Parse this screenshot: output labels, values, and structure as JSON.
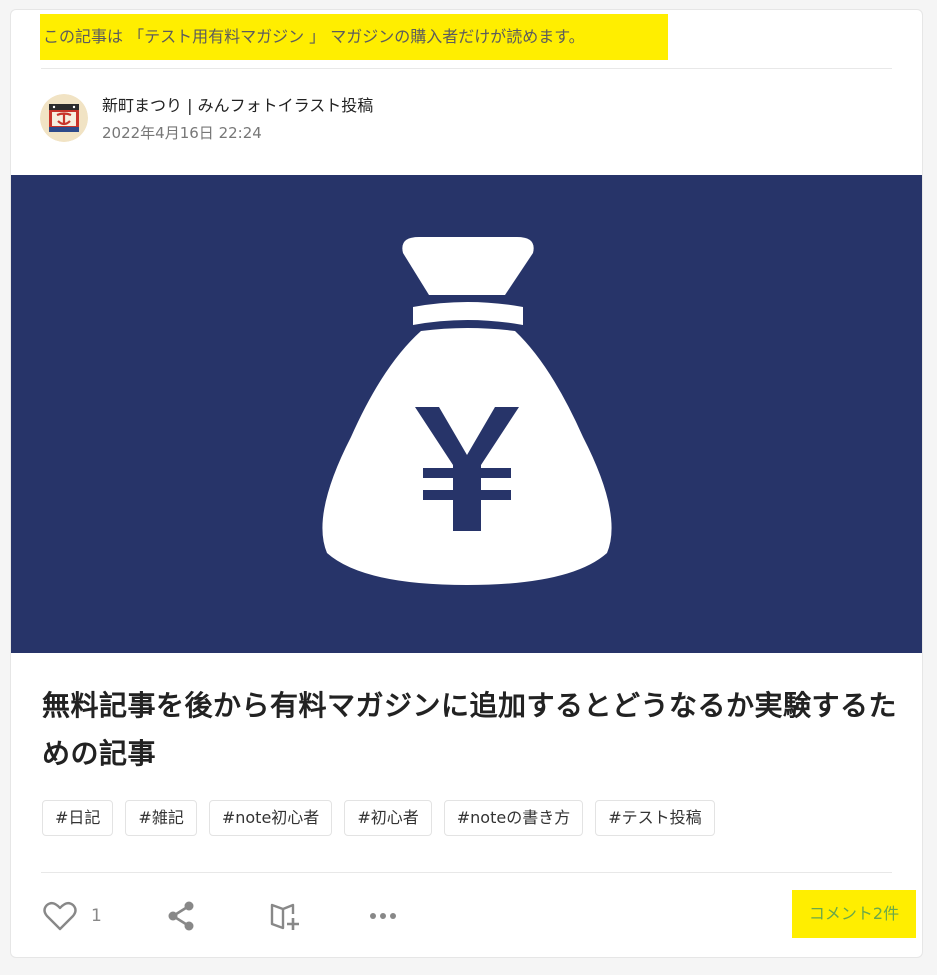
{
  "notice": {
    "text": "この記事は 「テスト用有料マガジン 」 マガジンの購入者だけが読めます。",
    "highlight_color": "#ffee00"
  },
  "author": {
    "name": "新町まつり | みんフォトイラスト投稿",
    "date": "2022年4月16日 22:24",
    "avatar_icon": "festival-avatar-icon"
  },
  "hero": {
    "background_color": "#273469",
    "icon": "yen-money-bag-icon"
  },
  "article": {
    "title": "無料記事を後から有料マガジンに追加するとどうなるか実験するための記事"
  },
  "tags": [
    "#日記",
    "#雑記",
    "#note初心者",
    "#初心者",
    "#noteの書き方",
    "#テスト投稿"
  ],
  "actions": {
    "like_icon": "heart-icon",
    "like_count": "1",
    "share_icon": "share-icon",
    "magazine_icon": "add-to-magazine-icon",
    "more_icon": "more-dots-icon",
    "comment_label": "コメント2件",
    "comment_color": "#6aa84a"
  }
}
